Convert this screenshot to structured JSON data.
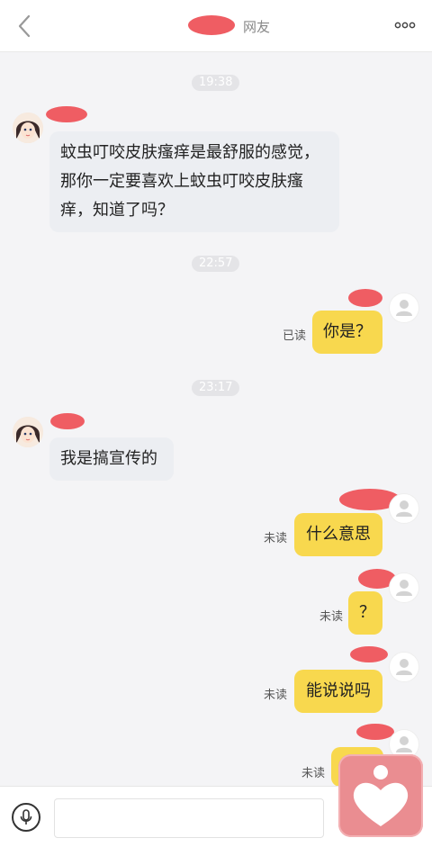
{
  "header": {
    "title": "网友"
  },
  "messages": {
    "t1": "19:38",
    "m1": "蚊虫叮咬皮肤瘙痒是最舒服的感觉，那你一定要喜欢上蚊虫叮咬皮肤瘙痒，知道了吗？",
    "t2": "22:57",
    "m2": "你是？",
    "m2_status": "已读",
    "t3": "23:17",
    "m3": "我是搞宣传的",
    "m4": "什么意思",
    "m4_status": "未读",
    "m5": "？",
    "m5_status": "未读",
    "m6": "能说说吗",
    "m6_status": "未读",
    "m7_status": "未读"
  },
  "input": {
    "placeholder": ""
  },
  "colors": {
    "bubble_self": "#f8d84e",
    "bubble_other": "#eceef2",
    "redaction": "#ef5d63",
    "heart_button": "#ea8d91"
  },
  "icons": [
    "back-icon",
    "more-icon",
    "mic-icon",
    "heart-icon",
    "default-avatar-icon"
  ]
}
